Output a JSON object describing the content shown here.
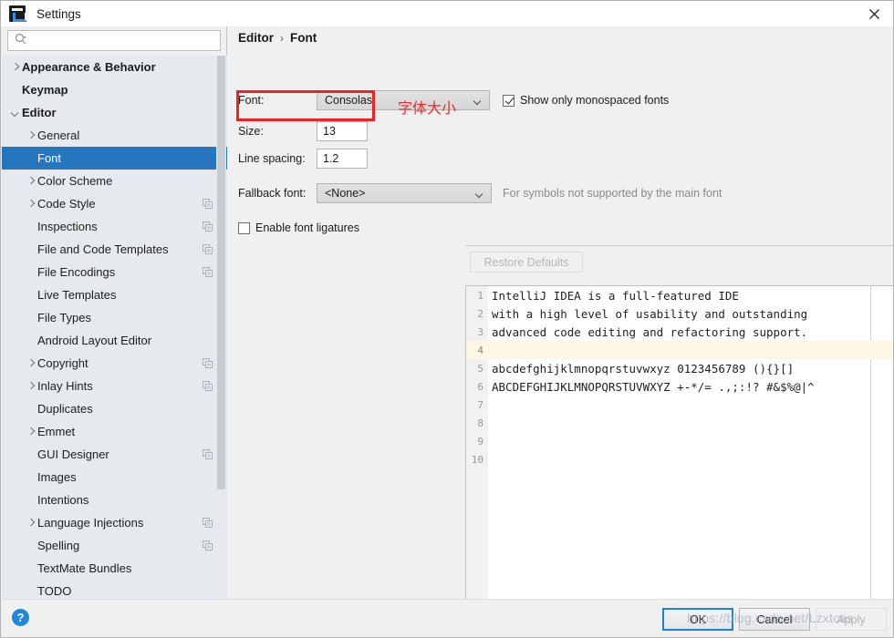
{
  "window": {
    "title": "Settings",
    "app_icon": "intellij-logo-icon",
    "close_icon": "close-icon"
  },
  "search": {
    "placeholder": "",
    "value": "",
    "icon": "search-icon"
  },
  "sidebar": {
    "items": [
      {
        "label": "Appearance & Behavior",
        "level": 0,
        "arrow": "collapsed",
        "bold": true,
        "selected": false,
        "copyable": false
      },
      {
        "label": "Keymap",
        "level": 0,
        "arrow": "none",
        "bold": true,
        "selected": false,
        "copyable": false
      },
      {
        "label": "Editor",
        "level": 0,
        "arrow": "expanded",
        "bold": true,
        "selected": false,
        "copyable": false
      },
      {
        "label": "General",
        "level": 1,
        "arrow": "collapsed",
        "bold": false,
        "selected": false,
        "copyable": false
      },
      {
        "label": "Font",
        "level": 1,
        "arrow": "none",
        "bold": false,
        "selected": true,
        "copyable": false
      },
      {
        "label": "Color Scheme",
        "level": 1,
        "arrow": "collapsed",
        "bold": false,
        "selected": false,
        "copyable": false
      },
      {
        "label": "Code Style",
        "level": 1,
        "arrow": "collapsed",
        "bold": false,
        "selected": false,
        "copyable": true
      },
      {
        "label": "Inspections",
        "level": 1,
        "arrow": "none",
        "bold": false,
        "selected": false,
        "copyable": true
      },
      {
        "label": "File and Code Templates",
        "level": 1,
        "arrow": "none",
        "bold": false,
        "selected": false,
        "copyable": true
      },
      {
        "label": "File Encodings",
        "level": 1,
        "arrow": "none",
        "bold": false,
        "selected": false,
        "copyable": true
      },
      {
        "label": "Live Templates",
        "level": 1,
        "arrow": "none",
        "bold": false,
        "selected": false,
        "copyable": false
      },
      {
        "label": "File Types",
        "level": 1,
        "arrow": "none",
        "bold": false,
        "selected": false,
        "copyable": false
      },
      {
        "label": "Android Layout Editor",
        "level": 1,
        "arrow": "none",
        "bold": false,
        "selected": false,
        "copyable": false
      },
      {
        "label": "Copyright",
        "level": 1,
        "arrow": "collapsed",
        "bold": false,
        "selected": false,
        "copyable": true
      },
      {
        "label": "Inlay Hints",
        "level": 1,
        "arrow": "collapsed",
        "bold": false,
        "selected": false,
        "copyable": true
      },
      {
        "label": "Duplicates",
        "level": 1,
        "arrow": "none",
        "bold": false,
        "selected": false,
        "copyable": false
      },
      {
        "label": "Emmet",
        "level": 1,
        "arrow": "collapsed",
        "bold": false,
        "selected": false,
        "copyable": false
      },
      {
        "label": "GUI Designer",
        "level": 1,
        "arrow": "none",
        "bold": false,
        "selected": false,
        "copyable": true
      },
      {
        "label": "Images",
        "level": 1,
        "arrow": "none",
        "bold": false,
        "selected": false,
        "copyable": false
      },
      {
        "label": "Intentions",
        "level": 1,
        "arrow": "none",
        "bold": false,
        "selected": false,
        "copyable": false
      },
      {
        "label": "Language Injections",
        "level": 1,
        "arrow": "collapsed",
        "bold": false,
        "selected": false,
        "copyable": true
      },
      {
        "label": "Spelling",
        "level": 1,
        "arrow": "none",
        "bold": false,
        "selected": false,
        "copyable": true
      },
      {
        "label": "TextMate Bundles",
        "level": 1,
        "arrow": "none",
        "bold": false,
        "selected": false,
        "copyable": false
      },
      {
        "label": "TODO",
        "level": 1,
        "arrow": "none",
        "bold": false,
        "selected": false,
        "copyable": false
      }
    ]
  },
  "breadcrumb": {
    "root": "Editor",
    "separator": "›",
    "current": "Font"
  },
  "form": {
    "font_label": "Font:",
    "font_value": "Consolas",
    "monospaced_label": "Show only monospaced fonts",
    "monospaced_checked": true,
    "size_label": "Size:",
    "size_value": "13",
    "size_annotation_cn": "字体大小",
    "line_spacing_label": "Line spacing:",
    "line_spacing_value": "1.2",
    "fallback_label": "Fallback font:",
    "fallback_value": "<None>",
    "fallback_hint": "For symbols not supported by the main font",
    "ligatures_label": "Enable font ligatures",
    "ligatures_checked": false,
    "restore_defaults_label": "Restore Defaults"
  },
  "preview": {
    "inspection_icon": "green-check-icon",
    "lines": [
      {
        "no": "1",
        "text": "IntelliJ IDEA is a full-featured IDE",
        "caret": false
      },
      {
        "no": "2",
        "text": "with a high level of usability and outstanding",
        "caret": false
      },
      {
        "no": "3",
        "text": "advanced code editing and refactoring support.",
        "caret": false
      },
      {
        "no": "4",
        "text": "",
        "caret": true
      },
      {
        "no": "5",
        "text": "abcdefghijklmnopqrstuvwxyz 0123456789 (){}[]",
        "caret": false
      },
      {
        "no": "6",
        "text": "ABCDEFGHIJKLMNOPQRSTUVWXYZ +-*/= .,;:!? #&$%@|^",
        "caret": false
      },
      {
        "no": "7",
        "text": "",
        "caret": false
      },
      {
        "no": "8",
        "text": "",
        "caret": false
      },
      {
        "no": "9",
        "text": "",
        "caret": false
      },
      {
        "no": "10",
        "text": "",
        "caret": false
      }
    ]
  },
  "footer": {
    "help_label": "?",
    "ok_label": "OK",
    "cancel_label": "Cancel",
    "apply_label": "Apply",
    "watermark": "https://blog.csdn.net/Lzxtcas"
  },
  "colors": {
    "selection": "#2675bf",
    "annotation_red": "#ee2a2a",
    "accent_blue": "#1b82dd",
    "caret_line": "#fdf8e3"
  }
}
